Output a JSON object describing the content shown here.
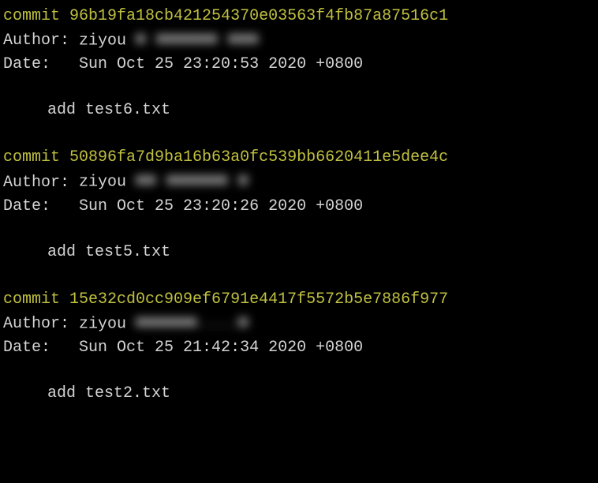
{
  "commits": [
    {
      "commit_label": "commit",
      "hash": "96b19fa18cb421254370e03563f4fb87a87516c1",
      "author_label": "Author:",
      "author_name": "ziyou",
      "author_email_obscured": "■ ■■■■■■ ■■■",
      "date_label": "Date:",
      "date_value": "Sun Oct 25 23:20:53 2020 +0800",
      "message": "add test6.txt"
    },
    {
      "commit_label": "commit",
      "hash": "50896fa7d9ba16b63a0fc539bb6620411e5dee4c",
      "author_label": "Author:",
      "author_name": "ziyou",
      "author_email_obscured": "■■ ■■■■■■ ■",
      "date_label": "Date:",
      "date_value": "Sun Oct 25 23:20:26 2020 +0800",
      "message": "add test5.txt"
    },
    {
      "commit_label": "commit",
      "hash": "15e32cd0cc909ef6791e4417f5572b5e7886f977",
      "author_label": "Author:",
      "author_name": "ziyou",
      "author_email_obscured": "■■■■■■....■",
      "date_label": "Date:",
      "date_value": "Sun Oct 25 21:42:34 2020 +0800",
      "message": "add test2.txt"
    }
  ]
}
